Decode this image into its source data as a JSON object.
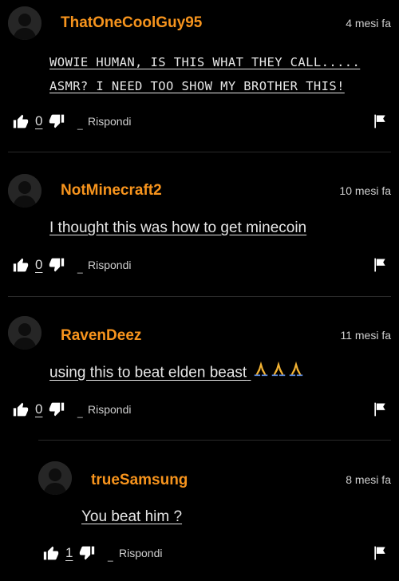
{
  "comments": [
    {
      "username": "ThatOneCoolGuy95",
      "time": "4 mesi fa",
      "lines": [
        "WOWIE HUMAN, IS THIS WHAT THEY CALL.....",
        "ASMR? I NEED TOO SHOW MY BROTHER THIS!"
      ],
      "likes": "0",
      "reply_label": "Rispondi"
    },
    {
      "username": "NotMinecraft2",
      "time": "10 mesi fa",
      "text": "I thought this was how to get minecoin",
      "likes": "0",
      "reply_label": "Rispondi"
    },
    {
      "username": "RavenDeez",
      "time": "11 mesi fa",
      "text": "using this to beat elden beast",
      "emoji": "praying-hands-x3",
      "likes": "0",
      "reply_label": "Rispondi"
    },
    {
      "username": "trueSamsung",
      "time": "8 mesi fa",
      "text": "You beat him ?",
      "likes": "1",
      "reply_label": "Rispondi",
      "is_reply": true
    }
  ],
  "colors": {
    "background": "#000000",
    "username": "#f7941d",
    "text": "#e6e6e6",
    "divider": "#2a2a2a"
  },
  "icons": [
    "avatar-placeholder",
    "thumbs-up-icon",
    "thumbs-down-icon",
    "flag-icon",
    "praying-hands-emoji"
  ]
}
